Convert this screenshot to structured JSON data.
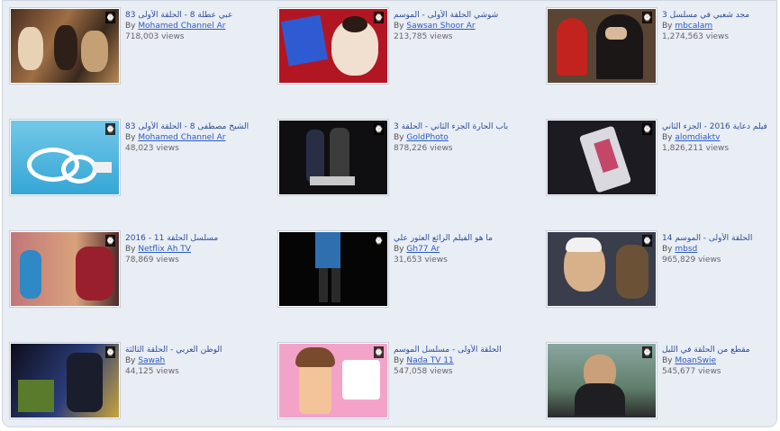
{
  "videos": [
    {
      "title": "عبي عطلة 8 - الحلقة الأولى 83",
      "channel": "Mohamed Channel Ar",
      "views": "718,003 views"
    },
    {
      "title": "شوشي الحلقة الأولى - الموسم",
      "channel": "Sawsan Shoor Ar",
      "views": "213,785 views"
    },
    {
      "title": "مجد شعبي في مسلسل 3",
      "channel": "mbcalam",
      "views": "1,274,563 views"
    },
    {
      "title": "الشيخ مصطفى 8 - الحلقة الأولى 83",
      "channel": "Mohamed Channel Ar",
      "views": "48,023 views"
    },
    {
      "title": "باب الحارة الجزء الثاني - الحلقة 3",
      "channel": "GoldPhoto",
      "views": "878,226 views"
    },
    {
      "title": "فيلم دعاية 2016 - الجزء الثاني",
      "channel": "alomdiaktv",
      "views": "1,826,211 views"
    },
    {
      "title": "مسلسل الحلقة 11 - 2016",
      "channel": "Netflix Ah TV",
      "views": "78,869 views"
    },
    {
      "title": "ما هو الفيلم الرائع العثور علي",
      "channel": "Gh77 Ar",
      "views": "31,653 views"
    },
    {
      "title": "الحلقة الأولى - الموسم 14",
      "channel": "mbsd",
      "views": "965,829 views"
    },
    {
      "title": "الوطن العربي - الحلقة الثالثة",
      "channel": "Sawah",
      "views": "44,125 views"
    },
    {
      "title": "الحلقة الأولى - مسلسل الموسم",
      "channel": "Nada TV 11",
      "views": "547,058 views"
    },
    {
      "title": "مقطع من الحلقة في الليل",
      "channel": "MoanSwie",
      "views": "545,677 views"
    }
  ],
  "by_label": "By",
  "badge_icon": "clock-icon"
}
